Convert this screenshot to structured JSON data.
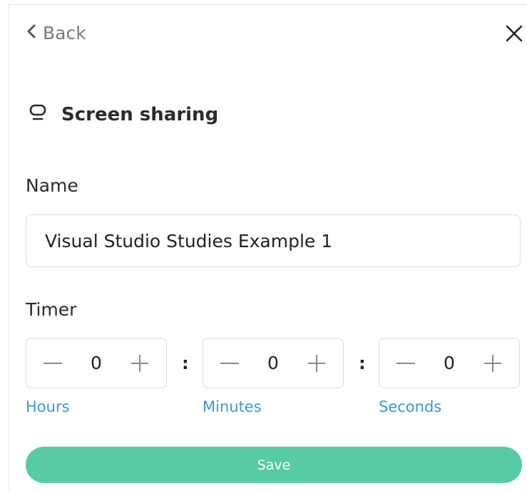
{
  "header": {
    "back_label": "Back",
    "back_icon": "chevron-left-icon",
    "close_icon": "close-icon"
  },
  "section": {
    "title": "Screen sharing",
    "icon": "monitor-icon"
  },
  "name_field": {
    "label": "Name",
    "value": "Visual Studio Studies Example 1"
  },
  "timer": {
    "label": "Timer",
    "separator": ":",
    "hours": {
      "value": "0",
      "label": "Hours"
    },
    "minutes": {
      "value": "0",
      "label": "Minutes"
    },
    "seconds": {
      "value": "0",
      "label": "Seconds"
    }
  },
  "actions": {
    "save_label": "Save"
  },
  "colors": {
    "accent": "#57cba5",
    "link": "#3a97dd",
    "muted": "#7a7a7a",
    "border": "#dcdcdc"
  }
}
